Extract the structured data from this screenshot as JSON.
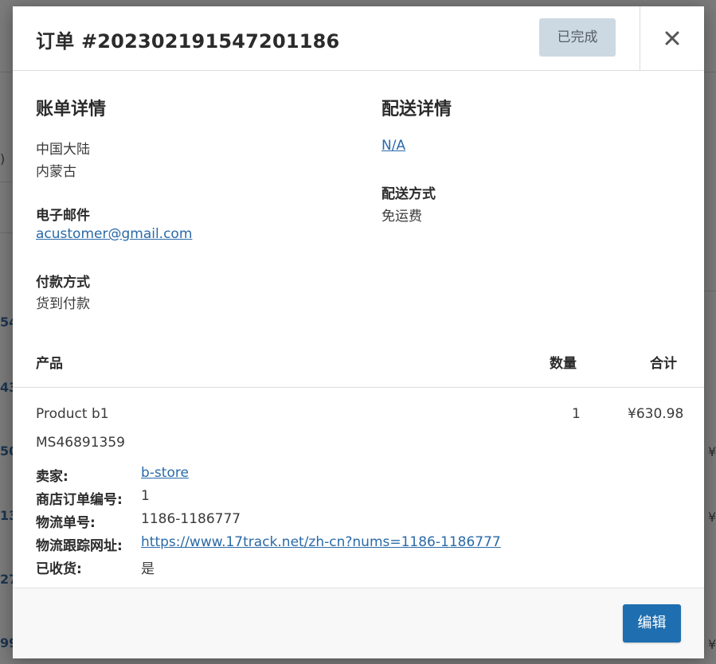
{
  "order": {
    "title": "订单 #202302191547201186",
    "status": "已完成",
    "close_symbol": "×"
  },
  "billing": {
    "title": "账单详情",
    "region": "中国大陆",
    "province": "内蒙古",
    "email_label": "电子邮件",
    "email": "acustomer@gmail.com",
    "payment_label": "付款方式",
    "payment": "货到付款"
  },
  "shipping": {
    "title": "配送详情",
    "address": "N/A",
    "method_label": "配送方式",
    "method": "免运费"
  },
  "table": {
    "headers": {
      "product": "产品",
      "quantity": "数量",
      "total": "合计"
    },
    "item": {
      "name": "Product b1",
      "sku": "MS46891359",
      "quantity": "1",
      "total": "¥630.98",
      "meta": {
        "seller_label": "卖家:",
        "seller": "b-store",
        "store_order_label": "商店订单编号:",
        "store_order": "1",
        "tracking_no_label": "物流单号:",
        "tracking_no": "1186-1186777",
        "tracking_url_label": "物流跟踪网址:",
        "tracking_url": "https://www.17track.net/zh-cn?nums=1186-1186777",
        "received_label": "已收货:",
        "received": "是"
      }
    }
  },
  "footer": {
    "edit_label": "编辑"
  },
  "background": {
    "left_fragments": [
      ")",
      "54",
      "43",
      "50",
      "13",
      "27",
      "99"
    ],
    "right_fragments": [
      "¥",
      "¥",
      "¥"
    ]
  }
}
